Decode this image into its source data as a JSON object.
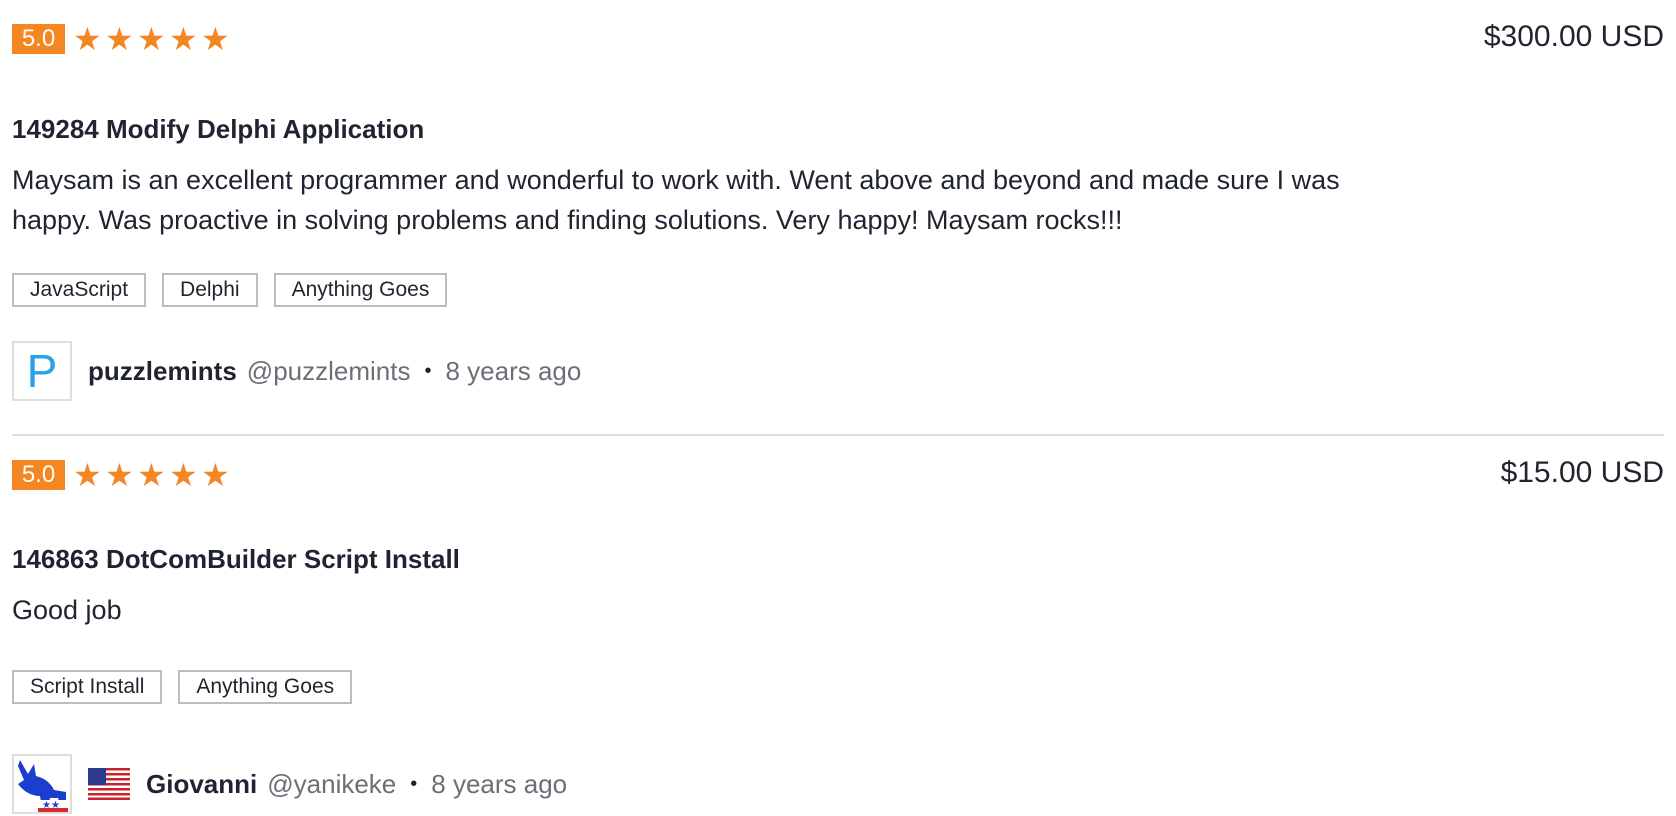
{
  "reviews": [
    {
      "rating": "5.0",
      "stars": 5,
      "price": "$300.00 USD",
      "project_title": "149284 Modify Delphi Application",
      "comment": "Maysam is an excellent programmer and wonderful to work with. Went above and beyond and made sure I was happy. Was proactive in solving problems and finding solutions. Very happy! Maysam rocks!!!",
      "tags": [
        "JavaScript",
        "Delphi",
        "Anything Goes"
      ],
      "user": {
        "avatar_letter": "P",
        "name": "puzzlemints",
        "handle": "@puzzlemints",
        "separator": "•",
        "time_ago": "8 years ago"
      }
    },
    {
      "rating": "5.0",
      "stars": 5,
      "price": "$15.00 USD",
      "project_title": "146863 DotComBuilder Script Install",
      "comment": "Good job",
      "tags": [
        "Script Install",
        "Anything Goes"
      ],
      "user": {
        "avatar_icon": "donkey-logo-icon",
        "flag_icon": "us-flag-icon",
        "name": "Giovanni",
        "handle": "@yanikeke",
        "separator": "•",
        "time_ago": "8 years ago"
      }
    }
  ],
  "colors": {
    "accent": "#f48722",
    "avatar_letter": "#29a3e6",
    "text": "#1f2430",
    "muted": "#6b6f77"
  }
}
